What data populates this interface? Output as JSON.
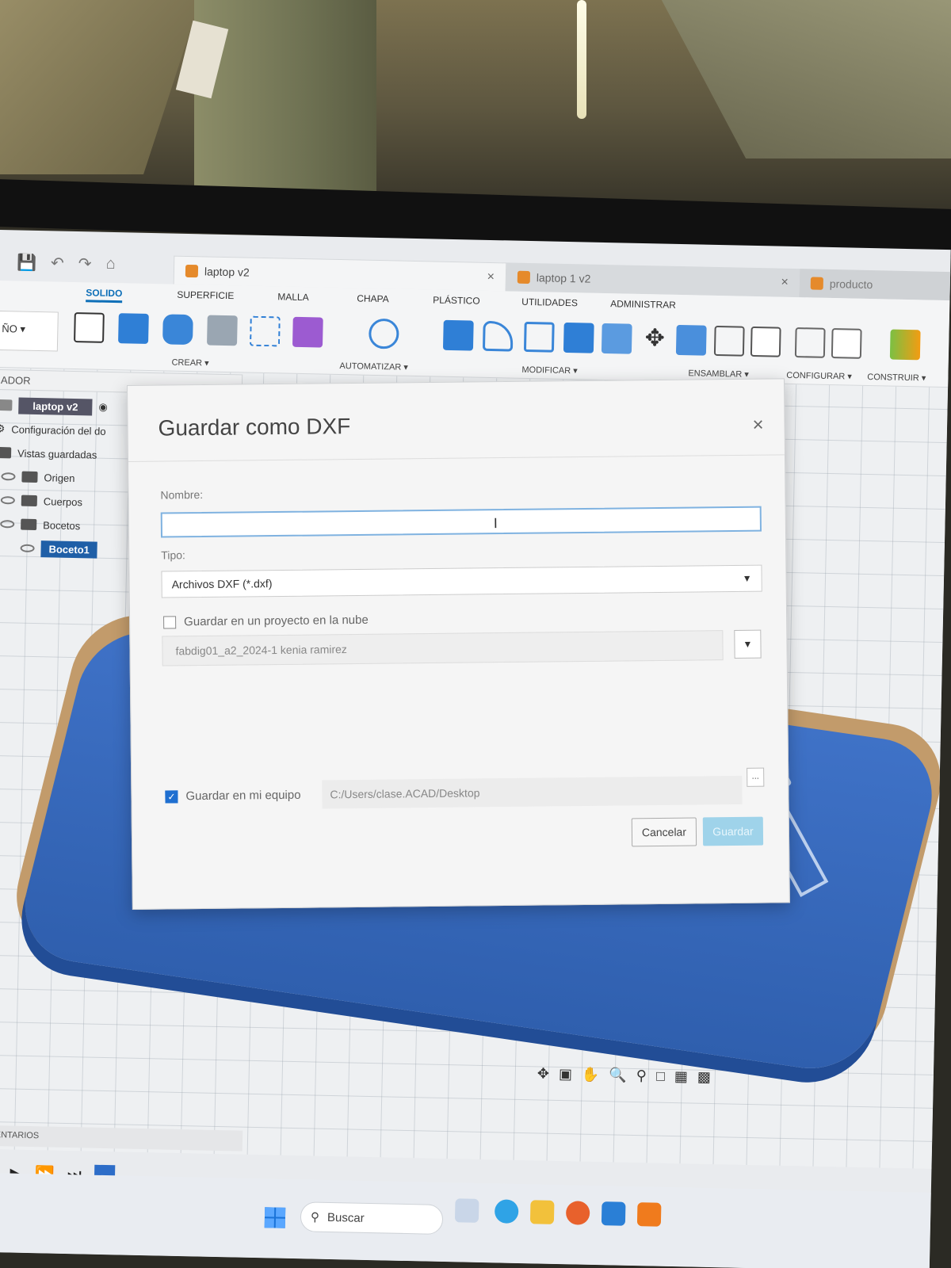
{
  "window": {
    "tabs": [
      {
        "label": "laptop v2",
        "active": true
      },
      {
        "label": "laptop 1 v2",
        "active": false
      },
      {
        "label": "producto",
        "active": false
      }
    ]
  },
  "ribbon": {
    "workspace": "ÑO",
    "tabs": [
      "SOLIDO",
      "SUPERFICIE",
      "MALLA",
      "CHAPA",
      "PLÁSTICO",
      "UTILIDADES",
      "ADMINISTRAR"
    ],
    "active_tab": "SOLIDO",
    "groups": {
      "crear": "CREAR",
      "automatizar": "AUTOMATIZAR",
      "modificar": "MODIFICAR",
      "ensamblar": "ENSAMBLAR",
      "configurar": "CONFIGURAR",
      "construir": "CONSTRUIR"
    }
  },
  "browser": {
    "header": "ADOR",
    "root": "laptop v2",
    "items": [
      {
        "label": "Configuración del do",
        "icon": "gear-icon"
      },
      {
        "label": "Vistas guardadas",
        "icon": "folder-icon"
      },
      {
        "label": "Origen",
        "icon": "folder-icon"
      },
      {
        "label": "Cuerpos",
        "icon": "folder-icon"
      },
      {
        "label": "Bocetos",
        "icon": "folder-icon"
      }
    ],
    "selected": "Boceto1"
  },
  "dialog": {
    "title": "Guardar como DXF",
    "name_label": "Nombre:",
    "name_value": "",
    "type_label": "Tipo:",
    "type_value": "Archivos DXF (*.dxf)",
    "cloud_checkbox": {
      "label": "Guardar en un proyecto en la nube",
      "checked": false
    },
    "cloud_project": "fabdig01_a2_2024-1 kenia ramirez",
    "local_checkbox": {
      "label": "Guardar en mi equipo",
      "checked": true
    },
    "local_path": "C:/Users/clase.ACAD/Desktop",
    "browse_label": "...",
    "cancel_label": "Cancelar",
    "save_label": "Guardar"
  },
  "bottom": {
    "comments_label": "OMENTARIOS"
  },
  "taskbar": {
    "search_placeholder": "Buscar"
  },
  "colors": {
    "accent": "#0d6fb8",
    "model_blue": "#3f72c7",
    "save_button_disabled": "#9fd3ea"
  }
}
